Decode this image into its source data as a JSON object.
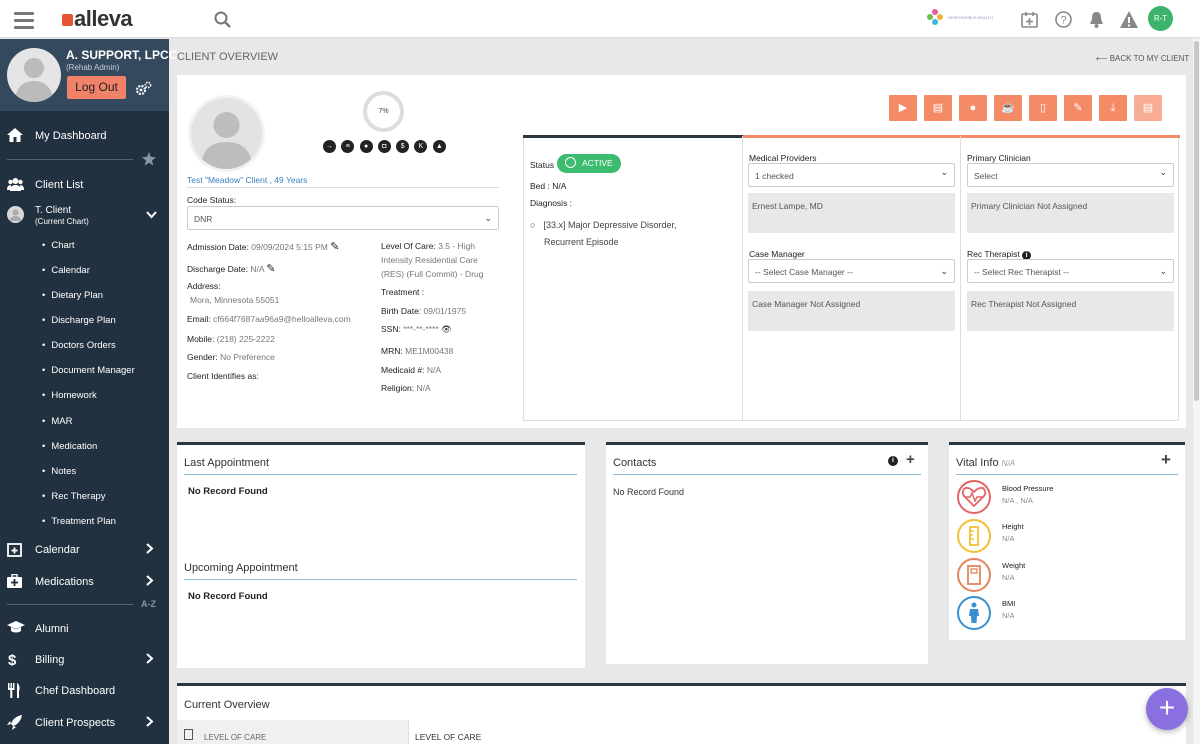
{
  "app": {
    "logo_text": "alleva",
    "partner_text": "RESPONSIBLE HEALTH"
  },
  "topbar": {
    "avatar_initials": "R-T"
  },
  "user": {
    "name": "A. SUPPORT, LPCC",
    "role": "(Rehab Admin)",
    "logout_label": "Log Out"
  },
  "sidebar": {
    "dashboard": "My Dashboard",
    "client_list": "Client List",
    "current_client": {
      "name": "T. Client",
      "note": "(Current Chart)"
    },
    "subitems": [
      "Chart",
      "Calendar",
      "Dietary Plan",
      "Discharge Plan",
      "Doctors Orders",
      "Document Manager",
      "Homework",
      "MAR",
      "Medication",
      "Notes",
      "Rec Therapy",
      "Treatment Plan"
    ],
    "calendar": "Calendar",
    "medications": "Medications",
    "az_label": "A-Z",
    "alumni": "Alumni",
    "billing": "Billing",
    "chef": "Chef Dashboard",
    "prospects": "Client Prospects"
  },
  "page": {
    "title": "CLIENT OVERVIEW",
    "back_link": "BACK TO MY CLIENT"
  },
  "client": {
    "progress": "7%",
    "name_line": "Test \"Meadow\" Client ,  49 Years",
    "code_status_label": "Code Status:",
    "code_status_value": "DNR",
    "admission_label": "Admission Date:",
    "admission_value": "09/09/2024 5:15 PM",
    "discharge_label": "Discharge Date:",
    "discharge_value": "N/A",
    "address_label": "Address:",
    "address_value": "Mora,  Minnesota  55051",
    "email_label": "Email:",
    "email_value": "cf664f7687aa96a9@helloalleva.com",
    "mobile_label": "Mobile:",
    "mobile_value": "(218) 225-2222",
    "gender_label": "Gender:",
    "gender_value": "No Preference",
    "identifies_label": "Client Identifies as:",
    "loc_label": "Level Of Care:",
    "loc_value1": "3.5 - High",
    "loc_value2": "Intensity Residential Care",
    "loc_value3": "(RES) (Full Commit) - Drug",
    "treatment_label": "Treatment :",
    "birth_label": "Birth Date:",
    "birth_value": "09/01/1975",
    "ssn_label": "SSN:",
    "ssn_value": "***-**-****",
    "mrn_label": "MRN:",
    "mrn_value": "ME1M00438",
    "medicaid_label": "Medicaid #:",
    "medicaid_value": "N/A",
    "religion_label": "Religion:",
    "religion_value": "N/A"
  },
  "details": {
    "status_label": "Status",
    "status_value": "ACTIVE",
    "bed_label": "Bed :",
    "bed_value": "N/A",
    "diagnosis_label": "Diagnosis :",
    "diagnosis_line1": "[33.x] Major Depressive Disorder,",
    "diagnosis_line2": "Recurrent Episode",
    "medical_providers_label": "Medical Providers",
    "medical_providers_value": "1 checked",
    "medical_provider_name": "Ernest Lampe, MD",
    "primary_clinician_label": "Primary Clinician",
    "primary_clinician_value": "Select",
    "primary_clinician_note": "Primary Clinician Not Assigned",
    "case_manager_label": "Case Manager",
    "case_manager_value": "-- Select Case Manager --",
    "case_manager_note": "Case Manager Not Assigned",
    "rec_therapist_label": "Rec Therapist",
    "rec_therapist_value": "-- Select Rec Therapist --",
    "rec_therapist_note": "Rec Therapist Not Assigned"
  },
  "appointments": {
    "last_title": "Last Appointment",
    "last_value": "No Record Found",
    "upcoming_title": "Upcoming Appointment",
    "upcoming_value": "No Record Found"
  },
  "contacts": {
    "title": "Contacts",
    "value": "No Record Found"
  },
  "vitals": {
    "title": "Vital Info",
    "title_note": "N/A",
    "items": [
      {
        "label": "Blood Pressure",
        "value": "N/A , N/A"
      },
      {
        "label": "Height",
        "value": "N/A"
      },
      {
        "label": "Weight",
        "value": "N/A"
      },
      {
        "label": "BMI",
        "value": "N/A"
      }
    ]
  },
  "overview": {
    "title": "Current Overview",
    "tab": "LEVEL OF CARE",
    "col": "LEVEL OF CARE"
  },
  "colors": {
    "accent": "#f48a66",
    "sidebar": "#22313f",
    "active": "#3dbb6e",
    "fab": "#8a6fe0"
  }
}
